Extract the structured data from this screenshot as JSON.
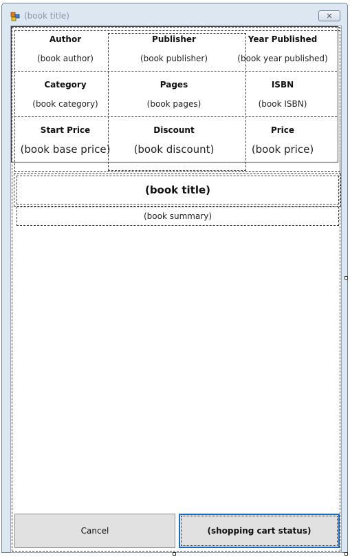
{
  "window": {
    "title": "(book title)",
    "close_glyph": "✕"
  },
  "book": {
    "title": "(book title)",
    "summary": "(book summary)"
  },
  "details": {
    "rows": [
      [
        {
          "label": "Author",
          "value": "(book author)"
        },
        {
          "label": "Publisher",
          "value": "(book publisher)"
        },
        {
          "label": "Year Published",
          "value": "(book year published)"
        }
      ],
      [
        {
          "label": "Category",
          "value": "(book category)"
        },
        {
          "label": "Pages",
          "value": "(book pages)"
        },
        {
          "label": "ISBN",
          "value": "(book ISBN)"
        }
      ],
      [
        {
          "label": "Start Price",
          "value": "(book base price)"
        },
        {
          "label": "Discount",
          "value": "(book discount)"
        },
        {
          "label": "Price",
          "value": "(book price)"
        }
      ]
    ]
  },
  "buttons": {
    "cancel": "Cancel",
    "cart_status": "(shopping cart status)"
  },
  "colors": {
    "focus_border": "#1c6bc0",
    "window_frame": "#dde7f2",
    "button_face": "#e1e1e1"
  }
}
